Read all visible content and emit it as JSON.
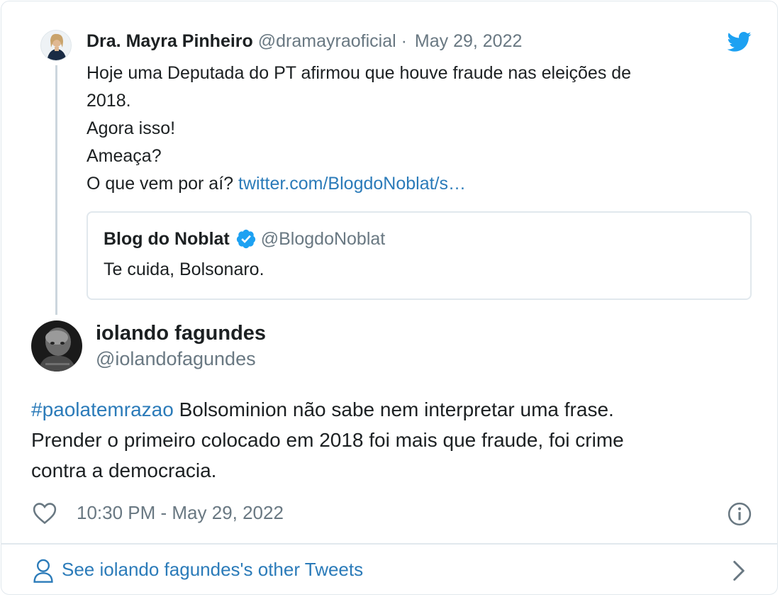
{
  "parent_tweet": {
    "author_name": "Dra. Mayra Pinheiro",
    "handle": "@dramayraoficial",
    "separator": "·",
    "date": "May 29, 2022",
    "text_lines": [
      "Hoje uma Deputada do PT afirmou que houve fraude nas eleições de",
      "2018.",
      "Agora isso!",
      "Ameaça?"
    ],
    "last_line_text": "O que vem por aí?",
    "last_line_link": "twitter.com/BlogdoNoblat/s…",
    "quote": {
      "author_name": "Blog do Noblat",
      "handle": "@BlogdoNoblat",
      "text": "Te cuida, Bolsonaro.",
      "verified_icon": "verified-badge-icon"
    }
  },
  "main_tweet": {
    "author_name": "iolando fagundes",
    "handle": "@iolandofagundes",
    "hashtag": "#paolatemrazao",
    "line1_rest": " Bolsominion não sabe nem interpretar uma frase.",
    "line2": "Prender o primeiro colocado em 2018 foi mais que fraude, foi crime",
    "line3": "contra a democracia.",
    "timestamp": "10:30 PM - May 29, 2022"
  },
  "footer": {
    "link_text": "See iolando fagundes's other Tweets"
  },
  "colors": {
    "link": "#2b7bb9",
    "twitter_blue": "#1da1f2",
    "muted": "#697882",
    "text": "#1c2022",
    "border": "#e1e8ed"
  },
  "icons": [
    "twitter-bird-icon",
    "verified-badge-icon",
    "heart-icon",
    "info-icon",
    "person-icon",
    "chevron-right-icon"
  ]
}
